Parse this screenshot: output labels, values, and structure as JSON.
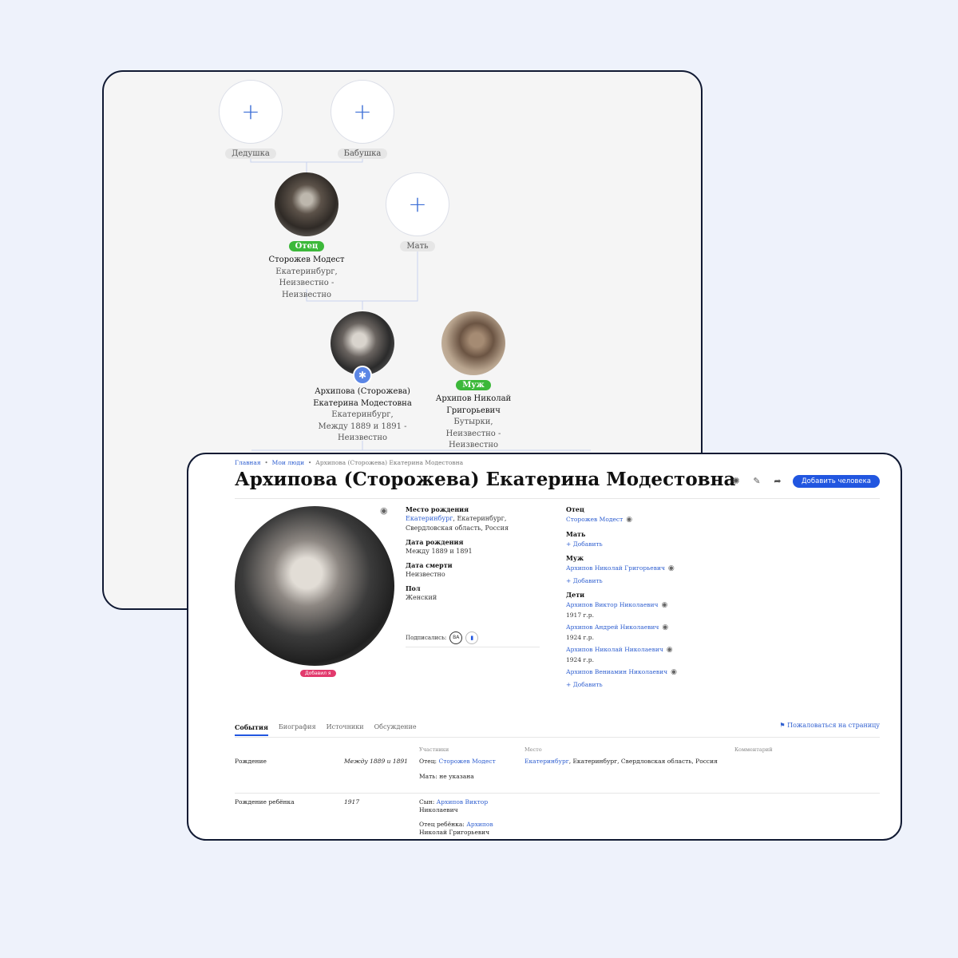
{
  "tree": {
    "grandfather": {
      "label": "Дедушка",
      "plus": "+"
    },
    "grandmother": {
      "label": "Бабушка",
      "plus": "+"
    },
    "mother": {
      "label": "Мать",
      "plus": "+"
    },
    "father": {
      "role": "Отец",
      "name": "Сторожев Модест",
      "line1": "Екатеринбург,",
      "line2": "Неизвестно -",
      "line3": "Неизвестно"
    },
    "self": {
      "name1": "Архипова (Сторожева)",
      "name2": "Екатерина Модестовна",
      "line1": "Екатеринбург,",
      "line2": "Между 1889 и 1891 -",
      "line3": "Неизвестно"
    },
    "husband": {
      "role": "Муж",
      "name1": "Архипов Николай",
      "name2": "Григорьевич",
      "line1": "Бутырки,",
      "line2": "Неизвестно -",
      "line3": "Неизвестно"
    }
  },
  "breadcrumb": {
    "home": "Главная",
    "sep": "•",
    "people": "Мои люди",
    "current": "Архипова (Сторожева) Екатерина Модестовна"
  },
  "profile": {
    "title": "Архипова (Сторожева) Екатерина Модестовна",
    "add_person_label": "Добавить человека",
    "added_by_label": "Добавил я",
    "facts": {
      "birth_place_label": "Место рождения",
      "birth_place_link": "Екатеринбург",
      "birth_place_rest": ", Екатеринбург, Свердловская область, Россия",
      "birth_date_label": "Дата рождения",
      "birth_date": "Между 1889 и 1891",
      "death_date_label": "Дата смерти",
      "death_date": "Неизвестно",
      "sex_label": "Пол",
      "sex": "Женский"
    },
    "subscribers_label": "Подписались:",
    "subscriber_initials": "ВА"
  },
  "relatives": {
    "father_label": "Отец",
    "father": "Сторожев Модест",
    "mother_label": "Мать",
    "add": "+ Добавить",
    "husband_label": "Муж",
    "husband": "Архипов Николай Григорьевич",
    "children_label": "Дети",
    "children": [
      {
        "name": "Архипов Виктор Николаевич",
        "year": "1917 г.р."
      },
      {
        "name": "Архипов Андрей Николаевич",
        "year": "1924 г.р."
      },
      {
        "name": "Архипов Николай Николаевич",
        "year": "1924 г.р."
      },
      {
        "name": "Архипов Вениамин Николаевич",
        "year": ""
      }
    ]
  },
  "tabs": [
    "События",
    "Биография",
    "Источники",
    "Обсуждение"
  ],
  "report_label": "Пожаловаться на страницу",
  "events": {
    "headers": {
      "participants": "Участники",
      "place": "Место",
      "comment": "Комментарий"
    },
    "rows": [
      {
        "event": "Рождение",
        "date": "Между 1889 и 1891",
        "p1_label": "Отец:",
        "p1_link": "Сторожев Модест",
        "p2_label": "Мать: не указана",
        "place_link": "Екатеринбург",
        "place_rest": ", Екатеринбург, Свердловская область, Россия"
      },
      {
        "event": "Рождение ребёнка",
        "date": "1917",
        "p1_label": "Сын:",
        "p1_link_a": "Архипов Виктор",
        "p1_link_b": "Николаевич",
        "p2_label": "Отец ребёнка:",
        "p2_link_a": "Архипов",
        "p2_link_b": "Николай Григорьевич"
      }
    ]
  },
  "colors": {
    "accent": "#2156e0",
    "green": "#3cb83a",
    "pink": "#e23a6d",
    "link": "#2f5fd0"
  }
}
